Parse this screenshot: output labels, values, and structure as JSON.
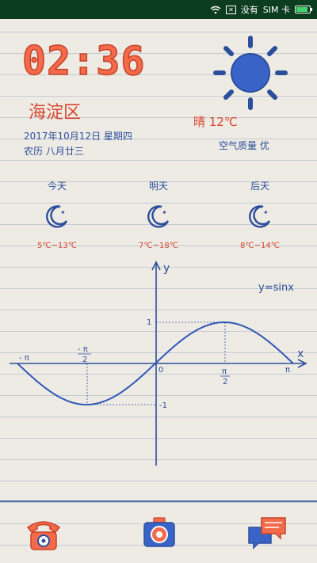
{
  "status": {
    "no_service": "没有",
    "sim": "SIM 卡",
    "battery_level": 0.9
  },
  "colors": {
    "accent_red": "#d8462f",
    "ink_blue": "#2c4f9c",
    "status_bg": "#0d3d1f"
  },
  "clock": {
    "time": "02:36"
  },
  "location": {
    "district": "海淀区"
  },
  "date": {
    "gregorian": "2017年10月12日 星期四",
    "lunar": "农历 八月廿三"
  },
  "weather": {
    "condition": "晴 12℃",
    "aqi": "空气质量 优",
    "icon": "sun-icon"
  },
  "forecast": [
    {
      "day": "今天",
      "temp": "5℃~13℃",
      "icon": "moon-icon"
    },
    {
      "day": "明天",
      "temp": "7℃~18℃",
      "icon": "moon-icon"
    },
    {
      "day": "后天",
      "temp": "8℃~14℃",
      "icon": "moon-icon"
    }
  ],
  "graph": {
    "equation": "y=sinx",
    "y_axis": "y",
    "x_axis": "x",
    "neg_pi": "- π",
    "pi": "π",
    "half_pi_num": "π",
    "half_pi_den": "2",
    "neg_half_pi_num": "- π",
    "neg_half_pi_den": "2",
    "one": "1",
    "neg_one": "-1",
    "origin": "0"
  },
  "dock": [
    {
      "icon": "phone-icon"
    },
    {
      "icon": "camera-icon"
    },
    {
      "icon": "messages-icon"
    }
  ]
}
